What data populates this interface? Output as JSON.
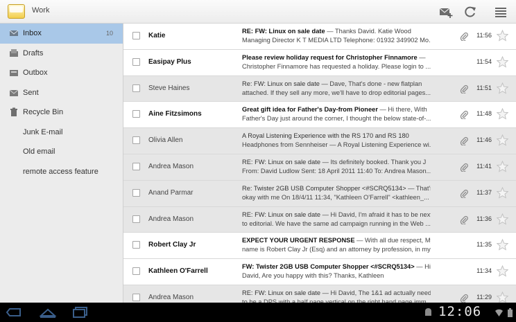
{
  "header": {
    "account": "Work"
  },
  "toolbar": {
    "compose_icon": "compose-mail-icon",
    "refresh_icon": "refresh-icon",
    "menu_icon": "overflow-menu-icon"
  },
  "folders": [
    {
      "label": "Inbox",
      "count": "10",
      "icon": "inbox-icon",
      "selected": true
    },
    {
      "label": "Drafts",
      "count": "",
      "icon": "drafts-icon"
    },
    {
      "label": "Outbox",
      "count": "",
      "icon": "outbox-icon"
    },
    {
      "label": "Sent",
      "count": "",
      "icon": "sent-icon"
    },
    {
      "label": "Recycle Bin",
      "count": "",
      "icon": "trash-icon"
    },
    {
      "label": "Junk E-mail",
      "count": ""
    },
    {
      "label": "Old email",
      "count": ""
    },
    {
      "label": "remote access feature",
      "count": ""
    }
  ],
  "messages": [
    {
      "sender": "Katie",
      "subject": "RE: FW: Linux on sale date",
      "preview1": " — Thanks David. Katie Wood",
      "preview2": "Managing Director K T MEDIA LTD Telephone: 01932 349902 Mo...",
      "time": "11:56",
      "unread": true,
      "attachment": true
    },
    {
      "sender": "Easipay Plus",
      "subject": "Please review holiday request for Christopher Finnamore",
      "preview1": " —",
      "preview2": "Christopher Finnamore has requested a holiday. Please login to ...",
      "time": "11:54",
      "unread": true,
      "attachment": false
    },
    {
      "sender": "Steve Haines",
      "subject": "Re: FW: Linux on sale date",
      "preview1": " — Dave, That's done - new flatplan",
      "preview2": "attached. If they sell any more, we'll have to drop editorial pages...",
      "time": "11:51",
      "unread": false,
      "attachment": true
    },
    {
      "sender": "Aine Fitzsimons",
      "subject": "Great gift idea for Father's Day-from Pioneer",
      "preview1": " — Hi there, With",
      "preview2": "Father's Day just around the corner, I thought the below state-of-...",
      "time": "11:48",
      "unread": true,
      "attachment": true
    },
    {
      "sender": "Olivia Allen",
      "subject": "A Royal Listening Experience with the RS 170 and RS 180",
      "preview1": "",
      "preview2": "Headphones from Sennheiser — A Royal Listening Experience wi...",
      "time": "11:46",
      "unread": false,
      "attachment": true
    },
    {
      "sender": "Andrea Mason",
      "subject": "RE: FW: Linux on sale date",
      "preview1": " — Its definitely booked. Thank you J",
      "preview2": "From: David Ludlow Sent: 18 April 2011 11:40 To: Andrea Mason...",
      "time": "11:41",
      "unread": false,
      "attachment": true
    },
    {
      "sender": "Anand Parmar",
      "subject": "Re: Twister 2GB USB Computer Shopper  <#SCRQ5134>",
      "preview1": " — That's",
      "preview2": "okay with me On 18/4/11 11:34, \"Kathleen O'Farrell\" <kathleen_...",
      "time": "11:37",
      "unread": false,
      "attachment": true
    },
    {
      "sender": "Andrea Mason",
      "subject": "RE: FW: Linux on sale date",
      "preview1": " — Hi David, I'm afraid it has to be next",
      "preview2": "to editorial. We have the same ad campaign running in the Web ...",
      "time": "11:36",
      "unread": false,
      "attachment": true
    },
    {
      "sender": "Robert Clay Jr",
      "subject": "EXPECT YOUR URGENT RESPONSE",
      "preview1": " — With all due respect, My",
      "preview2": "name is Robert Clay Jr (Esq) and an attorney by profession, in my...",
      "time": "11:35",
      "unread": true,
      "attachment": false
    },
    {
      "sender": "Kathleen O'Farrell",
      "subject": "FW: Twister 2GB USB Computer Shopper  <#SCRQ5134>",
      "preview1": " — Hi",
      "preview2": "David, Are you happy with this? Thanks, Kathleen",
      "time": "11:34",
      "unread": true,
      "attachment": false
    },
    {
      "sender": "Andrea Mason",
      "subject": "RE: FW: Linux on sale date",
      "preview1": " — Hi David, The 1&1 ad actually needs",
      "preview2": "to be a DPS with a half page vertical on the right hand page imm...",
      "time": "11:29",
      "unread": false,
      "attachment": true
    }
  ],
  "system": {
    "clock": "12:06"
  },
  "colors": {
    "selected_folder": "#a9c8e8",
    "unread_row": "#ffffff",
    "read_row": "#e6e6e6",
    "system_bar": "#000000"
  }
}
